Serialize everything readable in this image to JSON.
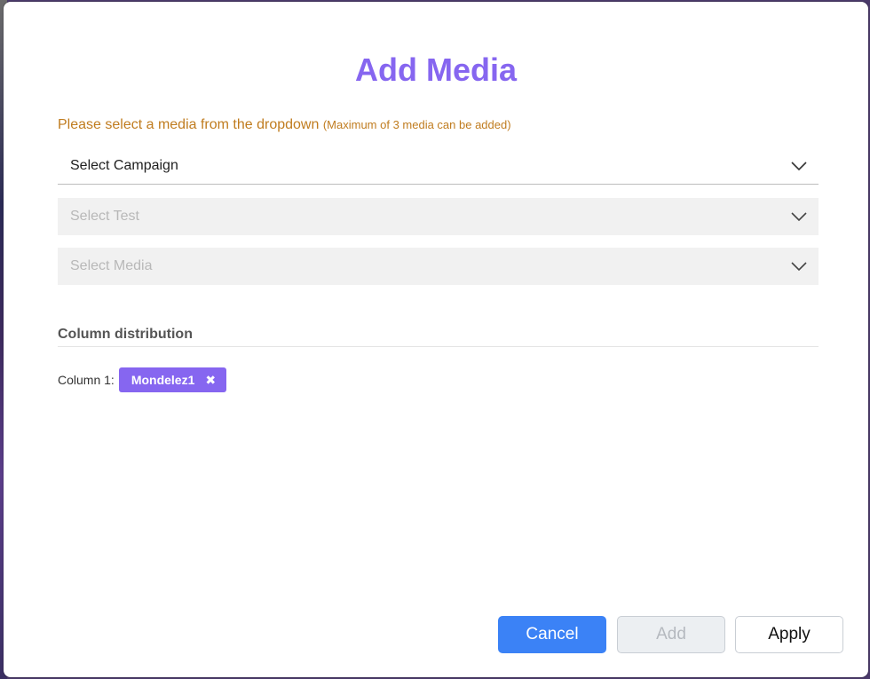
{
  "modal": {
    "title": "Add Media",
    "instruction": "Please select a media from the dropdown",
    "instruction_note": "(Maximum of 3 media can be added)"
  },
  "selects": {
    "campaign": {
      "placeholder": "Select Campaign",
      "enabled": true
    },
    "test": {
      "placeholder": "Select Test",
      "enabled": false
    },
    "media": {
      "placeholder": "Select Media",
      "enabled": false
    }
  },
  "column_distribution": {
    "title": "Column distribution",
    "columns": [
      {
        "label": "Column 1:",
        "chips": [
          {
            "name": "Mondelez1",
            "remove_glyph": "✖"
          }
        ]
      }
    ]
  },
  "buttons": {
    "cancel": "Cancel",
    "add": "Add",
    "apply": "Apply"
  },
  "colors": {
    "accent_purple": "#8666f0",
    "instruction_orange": "#c07c1f",
    "primary_blue": "#3b82f6"
  },
  "icons": {
    "dropdown": "chevron-down-icon",
    "chip_remove": "close-icon"
  }
}
